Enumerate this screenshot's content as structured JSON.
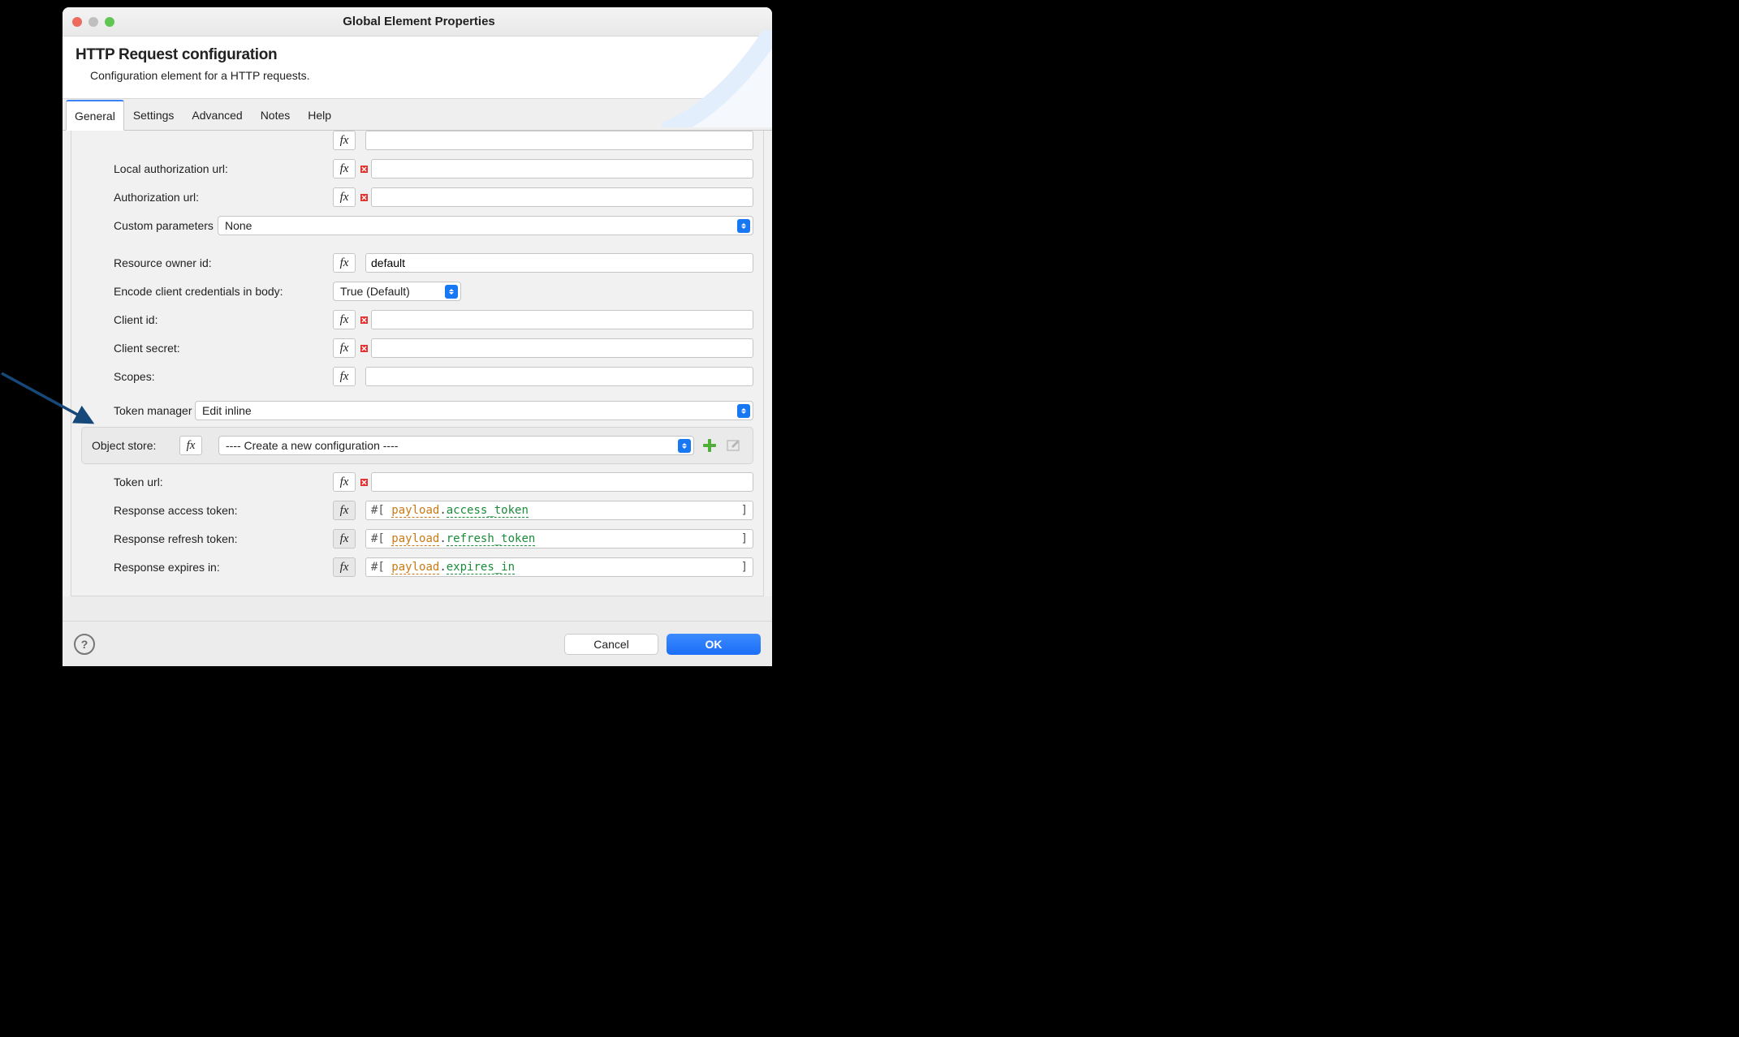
{
  "window": {
    "title": "Global Element Properties"
  },
  "header": {
    "title": "HTTP Request configuration",
    "subtitle": "Configuration element for a HTTP requests."
  },
  "tabs": {
    "items": [
      "General",
      "Settings",
      "Advanced",
      "Notes",
      "Help"
    ],
    "active": 0
  },
  "fx_label": "fx",
  "rows": {
    "cutoff": {
      "label": ""
    },
    "local_auth_url": {
      "label": "Local authorization url:",
      "value": ""
    },
    "auth_url": {
      "label": "Authorization url:",
      "value": ""
    },
    "custom_params": {
      "label": "Custom parameters",
      "select": "None"
    },
    "resource_owner_id": {
      "label": "Resource owner id:",
      "value": "default"
    },
    "encode_creds": {
      "label": "Encode client credentials in body:",
      "select": "True (Default)"
    },
    "client_id": {
      "label": "Client id:",
      "value": ""
    },
    "client_secret": {
      "label": "Client secret:",
      "value": ""
    },
    "scopes": {
      "label": "Scopes:",
      "value": ""
    },
    "token_manager": {
      "label": "Token manager",
      "select": "Edit inline"
    },
    "object_store": {
      "label": "Object store:",
      "select": "---- Create a new configuration ----"
    },
    "token_url": {
      "label": "Token url:",
      "value": ""
    },
    "resp_access": {
      "label": "Response access token:",
      "prefix": "#[ ",
      "p": "payload",
      "d": ".",
      "f": "access_token",
      "suffix": " ]"
    },
    "resp_refresh": {
      "label": "Response refresh token:",
      "prefix": "#[ ",
      "p": "payload",
      "d": ".",
      "f": "refresh_token",
      "suffix": " ]"
    },
    "resp_expires": {
      "label": "Response expires in:",
      "prefix": "#[ ",
      "p": "payload",
      "d": ".",
      "f": "expires_in",
      "suffix": " ]"
    }
  },
  "footer": {
    "cancel": "Cancel",
    "ok": "OK"
  }
}
